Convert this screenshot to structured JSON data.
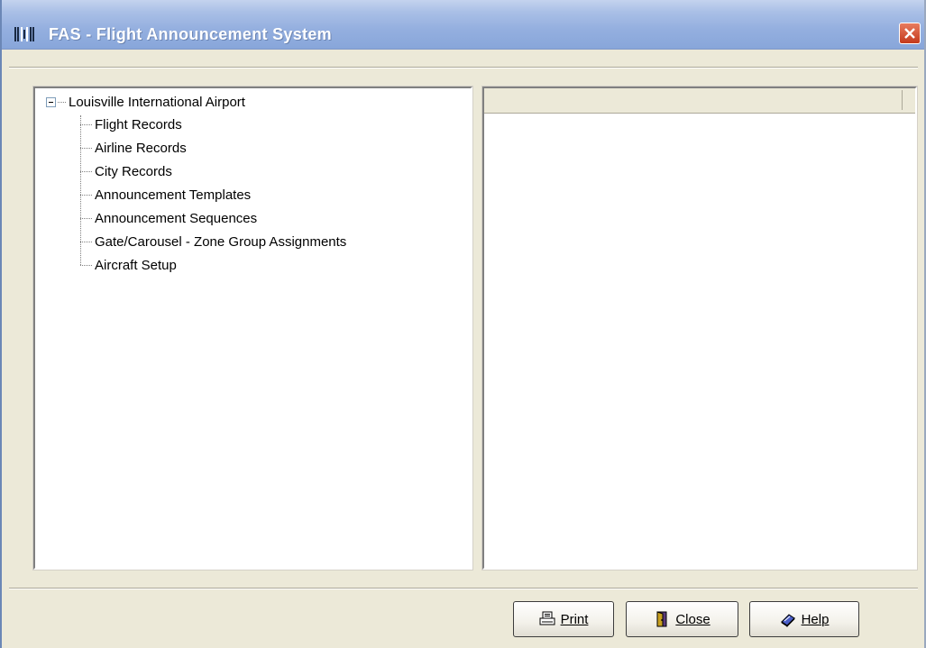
{
  "window": {
    "title": "FAS - Flight Announcement System"
  },
  "tree": {
    "root": "Louisville International Airport",
    "items": [
      "Flight Records",
      "Airline Records",
      "City Records",
      "Announcement Templates",
      "Announcement Sequences",
      "Gate/Carousel - Zone Group Assignments",
      "Aircraft Setup"
    ]
  },
  "buttons": {
    "print": "Print",
    "close": "Close",
    "help": "Help"
  },
  "icons": {
    "app": "app-logo-icon",
    "close": "close-icon",
    "print": "printer-icon",
    "close_button": "door-icon",
    "help": "book-icon"
  },
  "colors": {
    "titlebar": "#94afdf",
    "window_bg": "#ece9d8",
    "close_btn": "#c43a1c"
  }
}
